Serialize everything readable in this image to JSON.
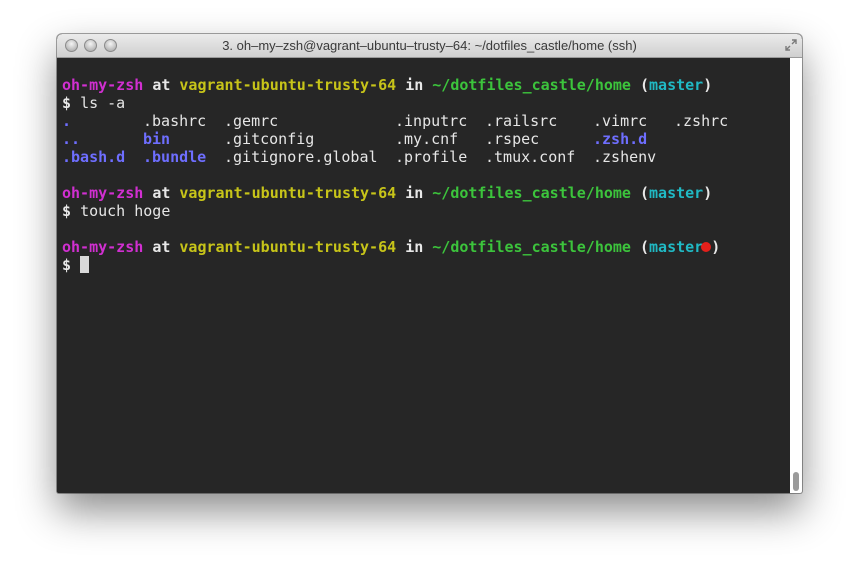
{
  "window": {
    "title": "3. oh–my–zsh@vagrant–ubuntu–trusty–64: ~/dotfiles_castle/home (ssh)"
  },
  "prompt": {
    "user": "oh-my-zsh",
    "at": "at",
    "host": "vagrant-ubuntu-trusty-64",
    "in": "in",
    "path": "~/dotfiles_castle/home",
    "open_paren": "(",
    "branch": "master",
    "close_paren": ")",
    "symbol": "$"
  },
  "commands": [
    "ls -a",
    "touch hoge"
  ],
  "ls_output": {
    "row1": [
      ".",
      ".bashrc",
      ".gemrc",
      ".inputrc",
      ".railsrc",
      ".vimrc",
      ".zshrc"
    ],
    "row2": [
      "..",
      "bin",
      ".gitconfig",
      ".my.cnf",
      ".rspec",
      ".zsh.d"
    ],
    "row3": [
      ".bash.d",
      ".bundle",
      ".gitignore.global",
      ".profile",
      ".tmux.conf",
      ".zshenv"
    ]
  },
  "colors": {
    "background": "#262626",
    "user": "#d12fd1",
    "host": "#c7c419",
    "path": "#3cc43c",
    "branch": "#20b9c4",
    "directory": "#6e6eff",
    "dirty_indicator": "#e3201b"
  },
  "icons": {
    "close": "traffic-light-close-icon",
    "minimize": "traffic-light-minimize-icon",
    "zoom": "traffic-light-zoom-icon",
    "fullscreen": "fullscreen-arrows-icon"
  }
}
